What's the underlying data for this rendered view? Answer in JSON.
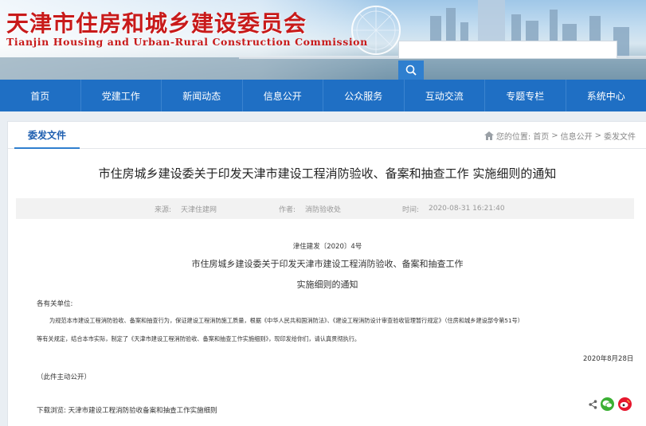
{
  "header": {
    "title_cn": "天津市住房和城乡建设委员会",
    "title_en": "Tianjin Housing and Urban-Rural Construction Commission",
    "search_placeholder": "",
    "search_icon": "search-icon"
  },
  "nav": {
    "items": [
      "首页",
      "党建工作",
      "新闻动态",
      "信息公开",
      "公众服务",
      "互动交流",
      "专题专栏",
      "系统中心"
    ]
  },
  "panel": {
    "tab_label": "委发文件",
    "breadcrumb": {
      "prefix": "您的位置:",
      "items": [
        "首页",
        "信息公开",
        "委发文件"
      ],
      "separator": ">"
    }
  },
  "article": {
    "title": "市住房城乡建设委关于印发天津市建设工程消防验收、备案和抽查工作 实施细则的通知",
    "meta": {
      "source_label": "来源:",
      "source_value": "天津住建网",
      "author_label": "作者:",
      "author_value": "消防验收处",
      "time_label": "时间:",
      "time_value": "2020-08-31 16:21:40"
    },
    "doc_number": "津住建发〔2020〕4号",
    "doc_title_line1": "市住房城乡建设委关于印发天津市建设工程消防验收、备案和抽查工作",
    "doc_title_line2": "实施细则的通知",
    "salutation": "各有关单位:",
    "paragraph_line1": "为规范本市建设工程消防验收、备案和抽查行为，保证建设工程消防施工质量，根据《中华人民共和国消防法》、《建设工程消防设计审查验收管理暂行规定》（住房和城乡建设部令第51号）",
    "paragraph_line2": "等有关规定，结合本市实际，制定了《天津市建设工程消防验收、备案和抽查工作实施细则》，现印发给你们，请认真贯彻执行。",
    "date": "2020年8月28日",
    "note": "（此件主动公开）",
    "download_label": "下载浏览:",
    "download_link": "天津市建设工程消防验收备案和抽查工作实施细则"
  },
  "share": {
    "icons": [
      "share-icon",
      "wechat-icon",
      "weibo-icon"
    ]
  },
  "colors": {
    "nav_bg": "#1f6fc4",
    "title_red": "#c81a1a",
    "accent_blue": "#2f7fcf",
    "wechat_green": "#3cb034",
    "weibo_red": "#e6162d"
  }
}
